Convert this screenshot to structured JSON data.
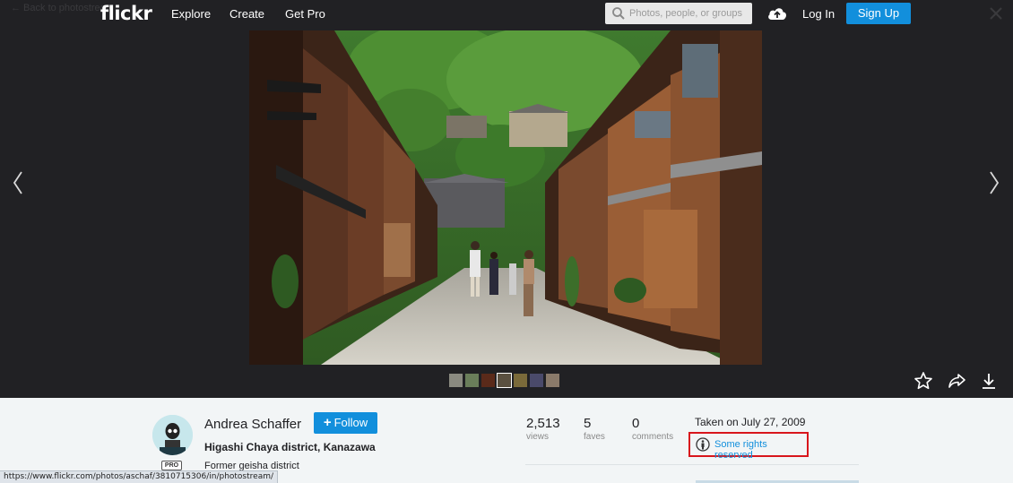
{
  "header": {
    "back_label": "← Back to photostream",
    "logo": "flickr",
    "nav": [
      "Explore",
      "Create",
      "Get Pro"
    ],
    "search_placeholder": "Photos, people, or groups",
    "login_label": "Log In",
    "signup_label": "Sign Up"
  },
  "photo": {
    "filmstrip_count": 7
  },
  "owner": {
    "name": "Andrea Schaffer",
    "follow_label": "Follow",
    "pro_badge": "PRO"
  },
  "details": {
    "title": "Higashi Chaya district, Kanazawa",
    "description": "Former geisha district"
  },
  "stats": {
    "views": {
      "value": "2,513",
      "label": "views"
    },
    "faves": {
      "value": "5",
      "label": "faves"
    },
    "comments": {
      "value": "0",
      "label": "comments"
    }
  },
  "meta": {
    "taken": "Taken on July 27, 2009",
    "license": "Some rights reserved"
  },
  "status_url": "https://www.flickr.com/photos/aschaf/3810715306/in/photostream/",
  "colors": {
    "background": "#212124",
    "accent": "#128fdc",
    "highlight_box": "#d8161c",
    "panel": "#f2f5f6"
  }
}
